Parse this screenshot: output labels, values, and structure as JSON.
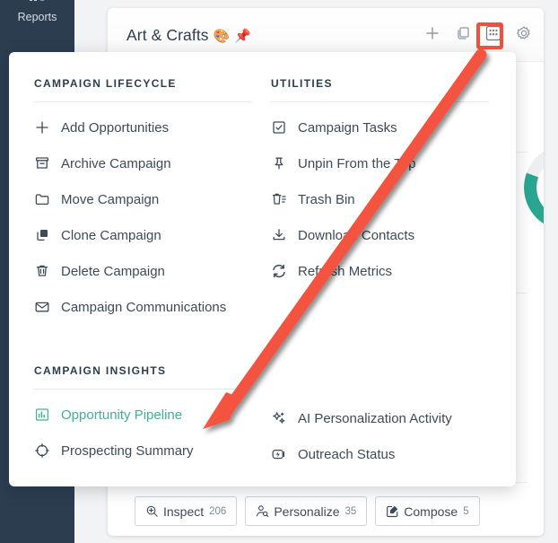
{
  "sidebar": {
    "items": [
      {
        "label": "Reports",
        "icon": "chart-dollar-icon"
      }
    ]
  },
  "card": {
    "title": "Art & Crafts",
    "title_emoji_palette": "🎨",
    "title_emoji_pin": "📌",
    "header_icons": [
      {
        "name": "plus-icon",
        "label": "+"
      },
      {
        "name": "copy-icon",
        "label": "Duplicate"
      },
      {
        "name": "grid-dots-icon",
        "label": "More actions"
      },
      {
        "name": "gear-icon",
        "label": "Settings"
      }
    ],
    "status_dot_color": "#22a06b",
    "gauge_label": "%",
    "accent_green": "#17a08b",
    "actions": [
      {
        "label": "Inspect",
        "count": "206",
        "icon": "magnifier-plus-icon"
      },
      {
        "label": "Personalize",
        "count": "35",
        "icon": "user-search-icon"
      },
      {
        "label": "Compose",
        "count": "5",
        "icon": "pencil-square-icon"
      }
    ]
  },
  "menu": {
    "sections": [
      {
        "id": "lifecycle",
        "title": "CAMPAIGN LIFECYCLE",
        "items": [
          {
            "label": "Add Opportunities",
            "icon": "plus-icon"
          },
          {
            "label": "Archive Campaign",
            "icon": "archive-icon"
          },
          {
            "label": "Move Campaign",
            "icon": "folder-icon"
          },
          {
            "label": "Clone Campaign",
            "icon": "clone-icon"
          },
          {
            "label": "Delete Campaign",
            "icon": "trash-icon"
          },
          {
            "label": "Campaign Communications",
            "icon": "envelope-icon"
          }
        ]
      },
      {
        "id": "utilities",
        "title": "UTILITIES",
        "items": [
          {
            "label": "Campaign Tasks",
            "icon": "checkbox-icon"
          },
          {
            "label": "Unpin From the Top",
            "icon": "pin-icon"
          },
          {
            "label": "Trash Bin",
            "icon": "trash-list-icon"
          },
          {
            "label": "Download Contacts",
            "icon": "download-icon"
          },
          {
            "label": "Refresh Metrics",
            "icon": "refresh-icon"
          }
        ]
      },
      {
        "id": "insights",
        "title": "CAMPAIGN INSIGHTS",
        "items": [
          {
            "label": "Opportunity Pipeline",
            "icon": "bar-chart-icon",
            "hovered": true
          },
          {
            "label": "Prospecting Summary",
            "icon": "crosshair-icon",
            "hovered": false
          }
        ]
      },
      {
        "id": "insights-right",
        "title": "",
        "items": [
          {
            "label": "AI Personalization Activity",
            "icon": "sparkles-icon",
            "hovered": false
          },
          {
            "label": "Outreach Status",
            "icon": "flash-badge-icon",
            "hovered": false
          }
        ]
      }
    ],
    "hover_color": "#3fb392"
  },
  "annotation": {
    "arrow_color": "#f2503d",
    "from": "grid-dots-icon",
    "to": "Opportunity Pipeline",
    "highlight_box_color": "#f2503d"
  }
}
